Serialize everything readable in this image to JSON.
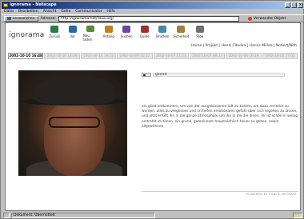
{
  "window": {
    "title": "ignorama - Netscape"
  },
  "menu": [
    "Datei",
    "Bearbeiten",
    "Ansicht",
    "Gehe",
    "Communicator",
    "Hilfe"
  ],
  "address_bar": {
    "bookmarks_label": "Lesezeichen",
    "address_label": "Adresse:",
    "url": "http://ignorama.net/sasa.org/",
    "related_label": "Verwandte Objekt"
  },
  "site": {
    "logo": "ignorama",
    "toolbar": [
      {
        "label": "Zurück",
        "icon": "back-icon"
      },
      {
        "label": "Vor",
        "icon": "forward-icon"
      },
      {
        "label": "Neu laden",
        "icon": "reload-icon"
      },
      {
        "label": "Anfang",
        "icon": "home-icon"
      },
      {
        "label": "Suchen",
        "icon": "search-icon"
      },
      {
        "label": "Guide",
        "icon": "guide-icon"
      },
      {
        "label": "Drucken",
        "icon": "print-icon"
      },
      {
        "label": "Sicherheit",
        "icon": "security-icon"
      },
      {
        "label": "Stop",
        "icon": "stop-icon"
      }
    ],
    "nav": "Home | Projekt | Hanzi Cibulka | Hanns Milleo | Notiert/Nith",
    "date_tabs": [
      {
        "label": "2002-10-10 16:48",
        "active": true
      },
      {
        "label": "2002-10-10 14:38",
        "active": false
      },
      {
        "label": "2002-10-10 14:23",
        "active": false
      },
      {
        "label": "2002-10-09 20:12",
        "active": false
      },
      {
        "label": "2002-10-07 21:23",
        "active": false
      },
      {
        "label": "2002-10-07 09:37",
        "active": false
      },
      {
        "label": "2002-10-06 16:19",
        "active": false
      },
      {
        "label": "2002-10-05 17:01",
        "active": false
      }
    ],
    "audio_file": "glueck",
    "article_text": "ein glied entkommen, um von der ausgebissenen luft zu kosten, um dazu verleitet zu werden, alles zu vergessen und im tiefen emotionalen gefühl über sich ergehen zu lassen, und jetzt erfüllt ihn in die ganze atmosphäre um ihn in die die ihnen. ihr ist schön in wenig erstrahlt im tönen, ein grund, gemeinsam hauptsächlich heuer zu gehen, sowie allgewöhnen.",
    "footer": "POWERED BY PUBLIC NETBASE"
  },
  "status": {
    "text": "Dokument: Übermittelt"
  }
}
